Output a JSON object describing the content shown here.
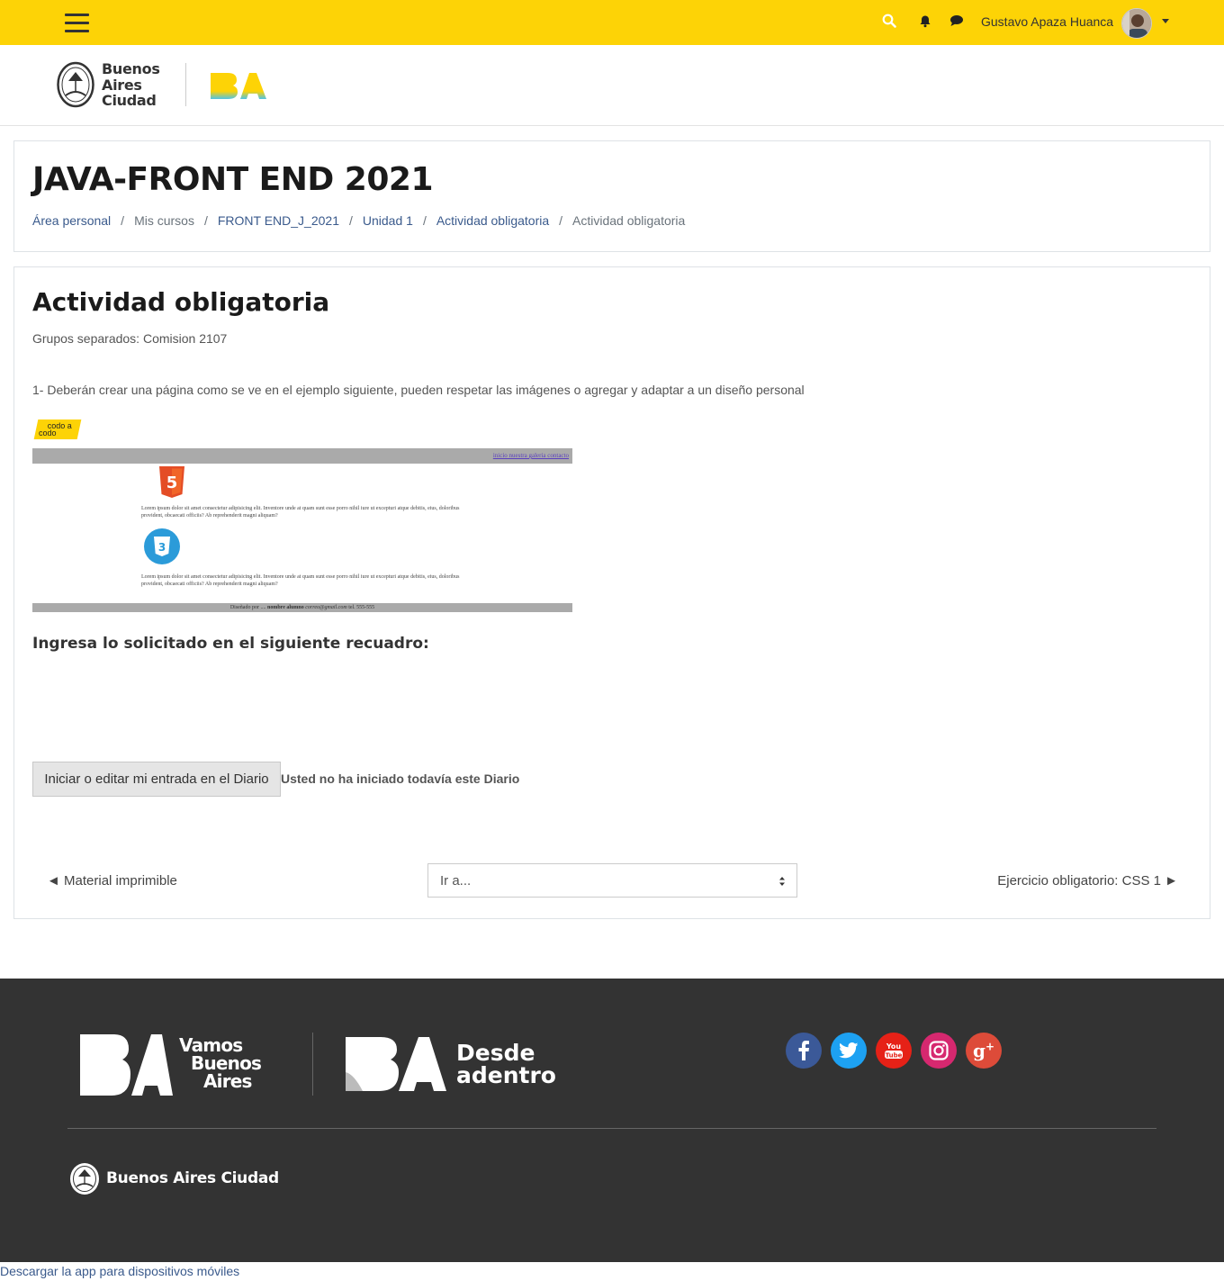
{
  "topbar": {
    "user_name": "Gustavo Apaza Huanca",
    "background": "#fdd306"
  },
  "brand": {
    "logo_text_line1": "Buenos",
    "logo_text_line2": "Aires",
    "logo_text_line3": "Ciudad",
    "ba_mark": "BA"
  },
  "header": {
    "course_title": "JAVA-FRONT END 2021",
    "breadcrumb": [
      {
        "label": "Área personal",
        "link": true
      },
      {
        "label": "Mis cursos",
        "link": false
      },
      {
        "label": "FRONT END_J_2021",
        "link": true
      },
      {
        "label": "Unidad 1",
        "link": true
      },
      {
        "label": "Actividad obligatoria",
        "link": true
      },
      {
        "label": "Actividad obligatoria",
        "link": false
      }
    ]
  },
  "activity": {
    "title": "Actividad obligatoria",
    "groups": "Grupos separados: Comision 2107",
    "instructions": "1- Deberán crear una página como se ve en el ejemplo siguiente, pueden respetar las imágenes o agregar y adaptar a un diseño personal",
    "codo_logo_line1": "codo a",
    "codo_logo_line2": "codo",
    "preview": {
      "nav_links": "inicio nuestra galeria contacto",
      "lorem1": "Lorem ipsum dolor sit amet consectetur adipisicing elit. Inventore unde at quam sunt esse porro nihil iure ut excepturi atque debitis, eius, doloribus provident, obcaecati officiis? Ab reprehenderit magni aliquam?",
      "lorem2": "Lorem ipsum dolor sit amet consectetur adipisicing elit. Inventore unde at quam sunt esse porro nihil iure ut excepturi atque debitis, eius, doloribus provident, obcaecati officiis? Ab reprehenderit magni aliquam?",
      "footer_prefix": "Diseñado por ....",
      "footer_name": "nombre alumno",
      "footer_email": "correo@gmail.com",
      "footer_tel": "tel. 555-555"
    },
    "prompt": "Ingresa lo solicitado en el siguiente recuadro:",
    "diary_button": "Iniciar o editar mi entrada en el Diario",
    "diary_status": "Usted no ha iniciado todavía este Diario"
  },
  "navigation": {
    "prev": "◄ Material imprimible",
    "jump_placeholder": "Ir a...",
    "next": "Ejercicio obligatorio: CSS 1 ►"
  },
  "footer": {
    "vamos_line1": "Vamos",
    "vamos_line2": "Buenos",
    "vamos_line3": "Aires",
    "desde_line1": "Desde",
    "desde_line2": "adentro",
    "city_name": "Buenos Aires Ciudad",
    "social": [
      {
        "name": "facebook",
        "glyph": "f",
        "color": "#3b5998"
      },
      {
        "name": "twitter",
        "glyph": "t",
        "color": "#1da1f2"
      },
      {
        "name": "youtube",
        "glyph": "You Tube",
        "color": "#e62117"
      },
      {
        "name": "instagram",
        "glyph": "",
        "color": "#d6286f"
      },
      {
        "name": "google-plus",
        "glyph": "g+",
        "color": "#dd4b39"
      }
    ]
  },
  "app_link": "Descargar la app para dispositivos móviles"
}
